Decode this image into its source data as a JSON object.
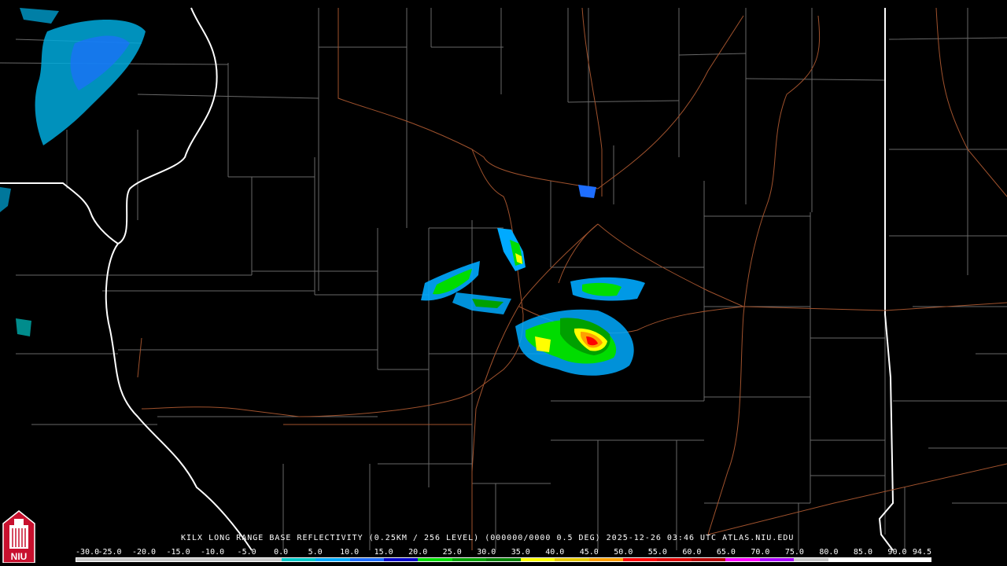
{
  "caption": {
    "station": "KILX",
    "product": "LONG RANGE BASE REFLECTIVITY",
    "resolution": "(0.25KM / 256 LEVEL)",
    "volume": "(000000/0000 0.5 DEG)",
    "datetime": "2025-12-26 03:46 UTC",
    "source": "ATLAS.NIU.EDU"
  },
  "logo": {
    "text": "NIU"
  },
  "scale": {
    "labels": [
      "-30.0",
      "-25.0",
      "-20.0",
      "-15.0",
      "-10.0",
      "-5.0",
      "0.0",
      "5.0",
      "10.0",
      "15.0",
      "20.0",
      "25.0",
      "30.0",
      "35.0",
      "40.0",
      "45.0",
      "50.0",
      "55.0",
      "60.0",
      "65.0",
      "70.0",
      "75.0",
      "80.0",
      "85.0",
      "90.0",
      "94.5"
    ],
    "colors": [
      "#c8c8c8",
      "#c8c8c8",
      "#c8c8c8",
      "#c8c8c8",
      "#c8c8c8",
      "#c8c8c8",
      "#00c8c8",
      "#00aaff",
      "#1e6eff",
      "#0000c8",
      "#00dc00",
      "#00a000",
      "#008000",
      "#ffff00",
      "#e6c800",
      "#ffa000",
      "#ff0000",
      "#dc0000",
      "#b40000",
      "#ff00ff",
      "#aa00ff",
      "#c8c8c8",
      "#ffffff",
      "#ffffff",
      "#ffffff"
    ]
  },
  "colors": {
    "background": "#000000",
    "county_lines": "#8c8c8c",
    "state_lines": "#ffffff",
    "highways": "#a0522d"
  }
}
